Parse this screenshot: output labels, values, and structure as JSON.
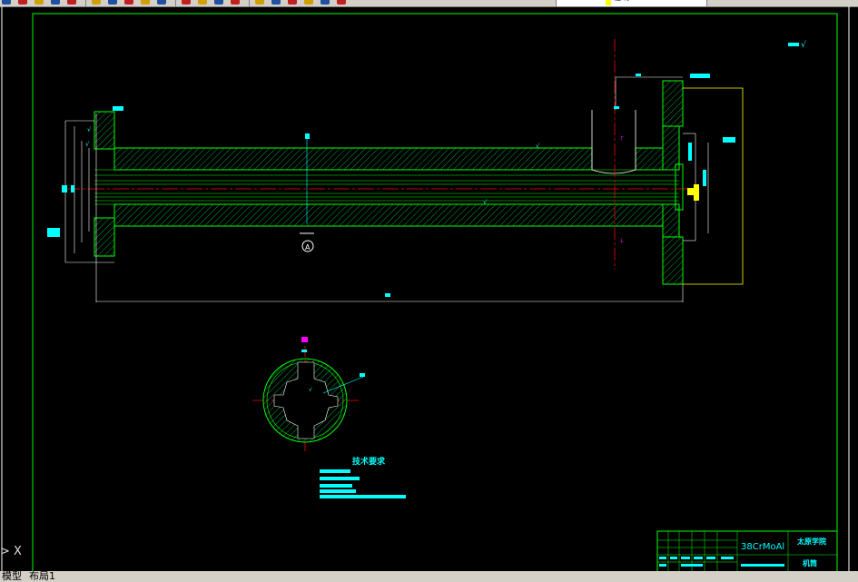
{
  "toolbar": {
    "buttons": [
      "open-icon",
      "save-icon",
      "print-icon",
      "preview-icon",
      "cut-icon",
      "copy-icon",
      "paste-icon",
      "match-icon",
      "undo-icon",
      "redo-icon",
      "pan-icon",
      "zoom-realtime-icon",
      "zoom-window-icon",
      "zoom-previous-icon",
      "properties-icon",
      "designcenter-icon",
      "toolpalette-icon",
      "markup-icon",
      "calculator-icon",
      "layer-icon"
    ],
    "colors": {
      "bg": "#d4d0c8",
      "icon_blue": "#2050a0",
      "icon_red": "#c02020",
      "icon_yellow": "#d0a000"
    }
  },
  "layer_combo": {
    "layer_name": "轴线",
    "color": "#ffff00"
  },
  "drawing": {
    "material": "38CrMoAl",
    "school": "太原学院",
    "part_name": "机筒",
    "section_label": "A",
    "tech_req_title": "技术要求",
    "colors": {
      "outline": "#00ff00",
      "dim": "#00ffff",
      "center": "#ff0000",
      "hatch": "#00b050",
      "highlight": "#ff00ff",
      "frame": "#00ff00",
      "aux": "#ffff00"
    }
  },
  "ucs": {
    "label": "X"
  },
  "layout_tabs": {
    "model": "模型",
    "layout1": "布局1"
  }
}
